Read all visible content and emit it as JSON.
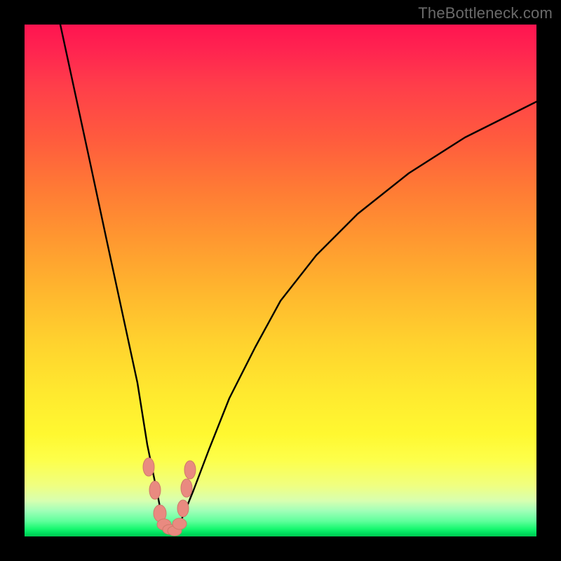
{
  "watermark": "TheBottleneck.com",
  "colors": {
    "background": "#000000",
    "gradient_top": "#ff1450",
    "gradient_mid": "#ffd22e",
    "gradient_bottom": "#00c850",
    "curve": "#000000",
    "marker_fill": "#e98a80",
    "marker_stroke": "#c96a5a"
  },
  "chart_data": {
    "type": "line",
    "title": "",
    "xlabel": "",
    "ylabel": "",
    "xlim": [
      0,
      100
    ],
    "ylim": [
      0,
      100
    ],
    "note": "Axes unlabeled; values are relative positions (percent of plot area). y=0 at bottom, y=100 at top. Curve is a V-shaped bottleneck: steep left branch, shallower right branch, minimum near x≈28.",
    "series": [
      {
        "name": "curve",
        "x": [
          7,
          10,
          13,
          16,
          19,
          22,
          24,
          26,
          27,
          28,
          29,
          30,
          31,
          33,
          36,
          40,
          45,
          50,
          57,
          65,
          75,
          86,
          100
        ],
        "y": [
          100,
          86,
          72,
          58,
          44,
          30,
          18,
          8,
          3,
          1,
          1,
          2,
          4,
          9,
          17,
          27,
          37,
          46,
          55,
          63,
          71,
          78,
          85
        ]
      }
    ],
    "markers": {
      "name": "highlight-points",
      "x": [
        24.3,
        25.5,
        26.5,
        27.3,
        28.3,
        29.3,
        30.3,
        31.0,
        31.6,
        32.3
      ],
      "y": [
        13.5,
        9.0,
        4.5,
        2.3,
        1.3,
        1.0,
        2.5,
        5.5,
        9.5,
        13.0
      ]
    }
  }
}
